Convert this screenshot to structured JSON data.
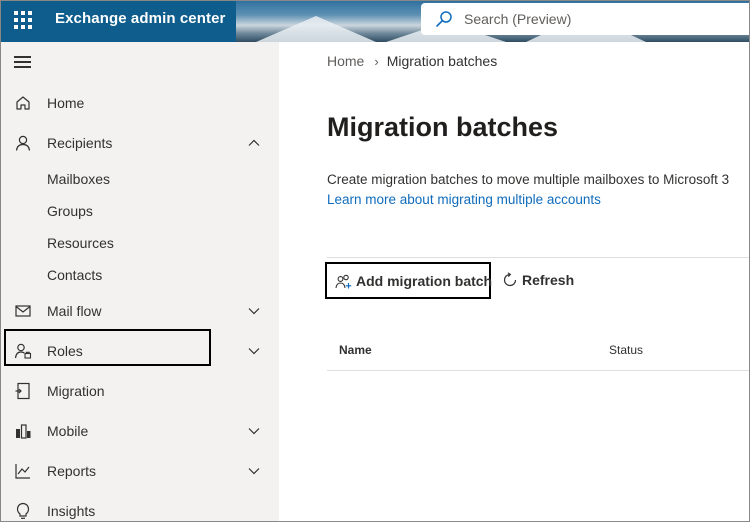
{
  "header": {
    "app_title": "Exchange admin center",
    "search_placeholder": "Search (Preview)",
    "icons": [
      "app-launcher-icon",
      "search-icon"
    ]
  },
  "sidebar": {
    "items": [
      {
        "label": "Home",
        "icon": "home-icon",
        "expandable": false
      },
      {
        "label": "Recipients",
        "icon": "person-icon",
        "expandable": true,
        "expanded": true,
        "children": [
          "Mailboxes",
          "Groups",
          "Resources",
          "Contacts"
        ]
      },
      {
        "label": "Mail flow",
        "icon": "mail-icon",
        "expandable": true,
        "expanded": false
      },
      {
        "label": "Roles",
        "icon": "roles-icon",
        "expandable": true,
        "expanded": false
      },
      {
        "label": "Migration",
        "icon": "migration-icon",
        "expandable": false,
        "highlighted": true
      },
      {
        "label": "Mobile",
        "icon": "mobile-icon",
        "expandable": true,
        "expanded": false
      },
      {
        "label": "Reports",
        "icon": "reports-icon",
        "expandable": true,
        "expanded": false
      },
      {
        "label": "Insights",
        "icon": "lightbulb-icon",
        "expandable": false
      }
    ]
  },
  "main": {
    "breadcrumb": [
      "Home",
      "Migration batches"
    ],
    "title": "Migration batches",
    "description": "Create migration batches to move multiple mailboxes to Microsoft 3",
    "learn_more": "Learn more about migrating multiple accounts",
    "commands": {
      "add": "Add migration batch",
      "refresh": "Refresh"
    },
    "table": {
      "columns": [
        "Name",
        "Status"
      ]
    }
  },
  "colors": {
    "header_bg": "#0f5d8c",
    "sidebar_bg": "#f3f2f1",
    "link": "#0f6cbd",
    "highlight_border": "#000000"
  }
}
